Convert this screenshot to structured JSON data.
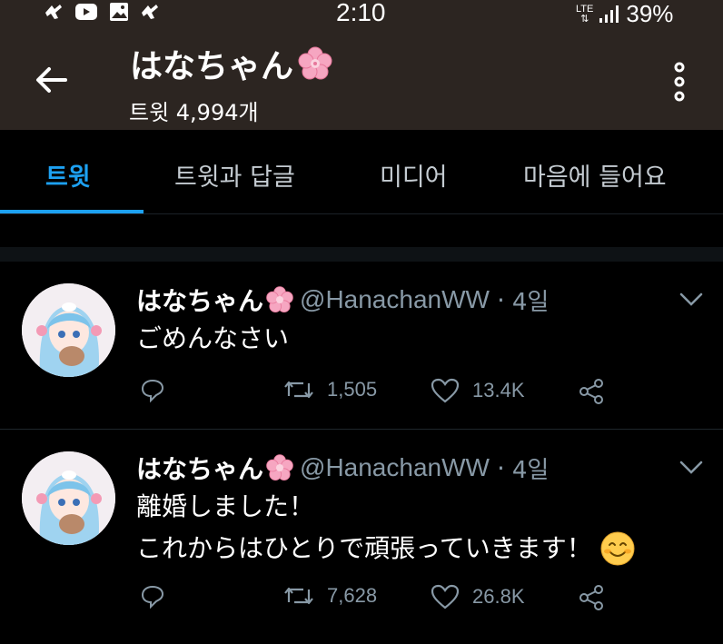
{
  "status": {
    "time": "2:10",
    "network": "LTE",
    "battery": "39%",
    "left_icons": [
      "notification-icon",
      "youtube-icon",
      "image-icon",
      "notification-icon"
    ]
  },
  "header": {
    "title": "はなちゃん",
    "title_emoji": "cherry-blossom-icon",
    "subtitle": "트윗 4,994개"
  },
  "tabs": [
    {
      "label": "트윗",
      "active": true
    },
    {
      "label": "트윗과 답글",
      "active": false
    },
    {
      "label": "미디어",
      "active": false
    },
    {
      "label": "마음에 들어요",
      "active": false
    }
  ],
  "tweets": [
    {
      "name": "はなちゃん",
      "handle": "@HanachanWW",
      "separator": "·",
      "time": "4일",
      "lines": [
        "ごめんなさい"
      ],
      "retweets": "1,505",
      "likes": "13.4K"
    },
    {
      "name": "はなちゃん",
      "handle": "@HanachanWW",
      "separator": "·",
      "time": "4일",
      "lines": [
        "離婚しました！",
        "これからはひとりで頑張っていきます！"
      ],
      "retweets": "7,628",
      "likes": "26.8K"
    }
  ],
  "colors": {
    "accent": "#1da1f2",
    "header_bg": "#2c2521",
    "muted": "#8899a6"
  }
}
